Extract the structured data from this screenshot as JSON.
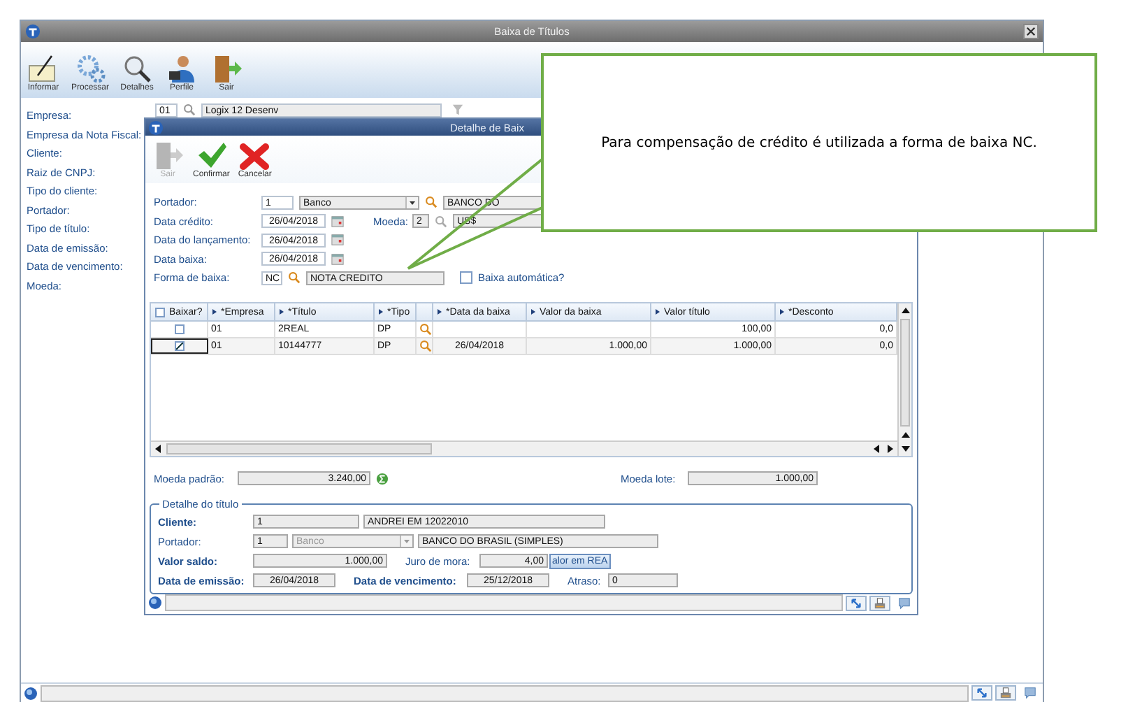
{
  "window": {
    "title": "Baixa de Títulos",
    "toolbar": [
      {
        "label": "Informar",
        "kind": "notepad"
      },
      {
        "label": "Processar",
        "kind": "gears"
      },
      {
        "label": "Detalhes",
        "kind": "magnifier"
      },
      {
        "label": "Perfile",
        "kind": "person"
      },
      {
        "label": "Sair",
        "kind": "door"
      }
    ],
    "empresa": {
      "code": "01",
      "name": "Logix 12 Desenv"
    },
    "labels": [
      "Empresa:",
      "Empresa da Nota Fiscal:",
      "Cliente:",
      "Raiz de CNPJ:",
      "Tipo do cliente:",
      "Portador:",
      "Tipo de título:",
      "Data de emissão:",
      "Data de vencimento:",
      "Moeda:"
    ]
  },
  "dialog": {
    "title": "Detalhe de Baix",
    "toolbar": [
      {
        "label": "Sair",
        "kind": "door",
        "disabled": true
      },
      {
        "label": "Confirmar",
        "kind": "check",
        "disabled": false
      },
      {
        "label": "Cancelar",
        "kind": "cross",
        "disabled": false
      }
    ],
    "portador": {
      "label": "Portador:",
      "code": "1",
      "type": "Banco",
      "disabled": false,
      "name": "BANCO DO"
    },
    "data_credito": {
      "label": "Data crédito:",
      "value": "26/04/2018"
    },
    "moeda": {
      "label": "Moeda:",
      "code": "2",
      "name": "US$"
    },
    "data_lancamento": {
      "label": "Data do lançamento:",
      "value": "26/04/2018"
    },
    "data_baixa": {
      "label": "Data baixa:",
      "value": "26/04/2018"
    },
    "forma_baixa": {
      "label": "Forma de  baixa:",
      "code": "NC",
      "name": "NOTA CREDITO"
    },
    "baixa_automatica": {
      "label": "Baixa automática?",
      "checked": false
    },
    "table": {
      "select_all": false,
      "columns": [
        {
          "label": "Baixar?",
          "kind": "check"
        },
        {
          "label": "*Empresa",
          "kind": "text"
        },
        {
          "label": "*Título",
          "kind": "text"
        },
        {
          "label": "*Tipo",
          "kind": "text"
        },
        {
          "kind": "lookup"
        },
        {
          "label": "*Data da baixa",
          "kind": "text"
        },
        {
          "label": "Valor da baixa",
          "kind": "text"
        },
        {
          "label": "Valor título",
          "kind": "text"
        },
        {
          "label": "*Desconto",
          "kind": "text"
        }
      ],
      "rows": [
        {
          "selected": false,
          "checked": false,
          "empresa": "01",
          "titulo": "2REAL",
          "tipo": "DP",
          "valor_titulo": "100,00",
          "desconto": "0,0"
        },
        {
          "selected": true,
          "checked": true,
          "empresa": "01",
          "titulo": "10144777",
          "tipo": "DP",
          "data_baixa": "26/04/2018",
          "valor_baixa": "1.000,00",
          "valor_titulo": "1.000,00",
          "desconto": "0,0"
        }
      ]
    },
    "moeda_padrao": {
      "label": "Moeda padrão:",
      "value": "3.240,00"
    },
    "moeda_lote": {
      "label": "Moeda lote:",
      "value": "1.000,00"
    },
    "detalhe": {
      "legend": "Detalhe do título",
      "cliente": {
        "label": "Cliente:",
        "bold": true,
        "code": "1",
        "name": "ANDREI EM 12022010"
      },
      "portador": {
        "label": "Portador:",
        "bold": false,
        "code": "1",
        "type": "Banco",
        "disabled": true,
        "name": "BANCO DO BRASIL (SIMPLES)"
      },
      "valor_saldo": {
        "label": "Valor saldo:",
        "bold": true,
        "value": "1.000,00"
      },
      "juro_mora": {
        "label": "Juro de mora:",
        "bold": false,
        "value": "4,00"
      },
      "valor_button": "alor em REA",
      "data_emissao": {
        "label": "Data de emissão:",
        "bold": true,
        "value": "26/04/2018"
      },
      "data_vencimento": {
        "label": "Data de vencimento:",
        "bold": true,
        "value": "25/12/2018"
      },
      "atraso": {
        "label": "Atraso:",
        "bold": false,
        "value": "0"
      }
    }
  },
  "callout": {
    "text": "Para compensação de crédito é utilizada a forma de baixa NC."
  }
}
